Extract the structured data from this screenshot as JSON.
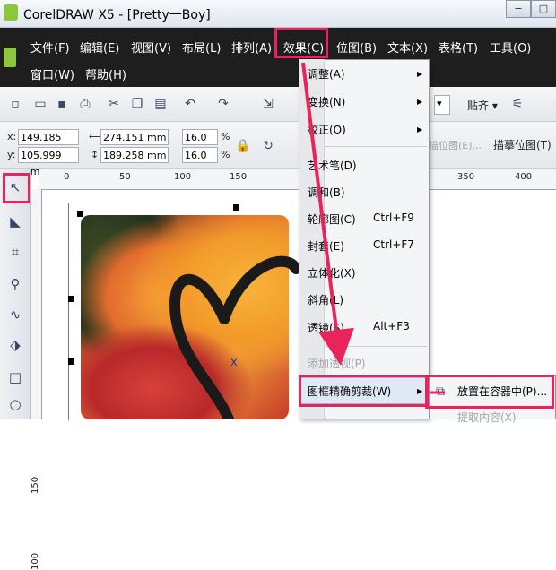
{
  "window": {
    "title": "CorelDRAW X5 - [Pretty一Boy]",
    "buttons": [
      "−",
      "□"
    ]
  },
  "menubar": {
    "row1": [
      "文件(F)",
      "编辑(E)",
      "视图(V)",
      "布局(L)",
      "排列(A)",
      "效果(C)",
      "位图(B)",
      "文本(X)",
      "表格(T)",
      "工具(O)"
    ],
    "row2": [
      "窗口(W)",
      "帮助(H)"
    ]
  },
  "toolbar": {
    "snap_label": "贴齐 ▾",
    "bitmap_label": "描位图(E)...",
    "trace_bitmap": "描摹位图(T)"
  },
  "props": {
    "x_label": "x:",
    "x": "149.185 mm",
    "y_label": "y:",
    "y": "105.999 mm",
    "w": "274.151 mm",
    "h": "189.258 mm",
    "scale_w": "16.0",
    "scale_h": "16.0",
    "pct": "%"
  },
  "ruler": {
    "h": [
      "0",
      "50",
      "100",
      "150",
      "350",
      "400"
    ],
    "v": [
      "150",
      "100"
    ]
  },
  "effects_menu": {
    "items": [
      {
        "label": "调整(A)",
        "shortcut": "",
        "arrow": true
      },
      {
        "label": "变换(N)",
        "shortcut": "",
        "arrow": true
      },
      {
        "label": "校正(O)",
        "shortcut": "",
        "arrow": true
      },
      {
        "label": "艺术笔(D)",
        "shortcut": ""
      },
      {
        "label": "调和(B)",
        "shortcut": ""
      },
      {
        "label": "轮廓图(C)",
        "shortcut": "Ctrl+F9"
      },
      {
        "label": "封套(E)",
        "shortcut": "Ctrl+F7"
      },
      {
        "label": "立体化(X)",
        "shortcut": ""
      },
      {
        "label": "斜角(L)",
        "shortcut": ""
      },
      {
        "label": "透镜(S)",
        "shortcut": "Alt+F3"
      },
      {
        "label": "添加透视(P)",
        "shortcut": ""
      },
      {
        "label": "图框精确剪裁(W)",
        "shortcut": ""
      }
    ]
  },
  "submenu": {
    "items": [
      "放置在容器中(P)...",
      "提取内容(X)"
    ]
  },
  "colors": {
    "highlight": "#e8245c",
    "menubar": "#1e1e1e"
  }
}
